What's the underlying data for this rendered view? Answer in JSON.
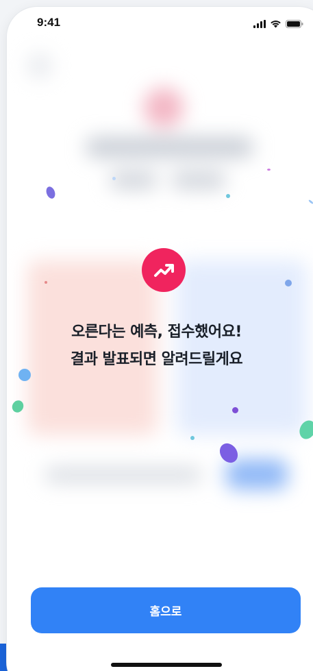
{
  "status_bar": {
    "time": "9:41",
    "icons": [
      "signal-icon",
      "wifi-icon",
      "battery-icon"
    ]
  },
  "message": {
    "line1": "오른다는 예측, 접수했어요!",
    "line2": "결과 발표되면 알려드릴게요"
  },
  "hero_icon": "trending-up-icon",
  "home_button": {
    "label": "홈으로"
  },
  "colors": {
    "accent": "#3182f6",
    "hero": "#f0245e",
    "text": "#191f28"
  }
}
